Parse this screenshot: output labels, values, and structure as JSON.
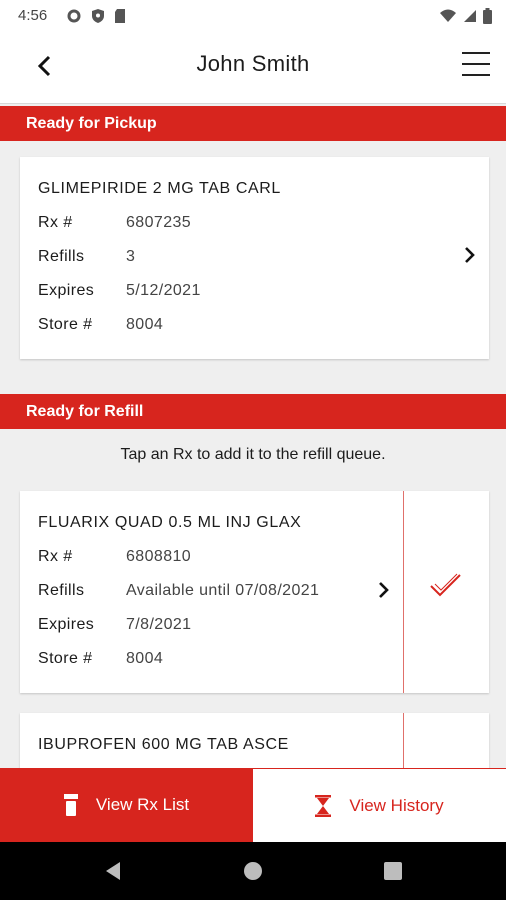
{
  "status_bar": {
    "time": "4:56"
  },
  "header": {
    "title": "John Smith"
  },
  "pickup": {
    "section_title": "Ready for Pickup",
    "card": {
      "name": "GLIMEPIRIDE 2 MG   TAB CARL",
      "rx_label": "Rx #",
      "rx": "6807235",
      "refills_label": "Refills",
      "refills": "3",
      "expires_label": "Expires",
      "expires": "5/12/2021",
      "store_label": "Store #",
      "store": "8004"
    }
  },
  "refill": {
    "section_title": "Ready for Refill",
    "hint": "Tap an Rx to add it to the refill queue.",
    "cards": [
      {
        "name": "FLUARIX QUAD 0.5 ML INJ GLAX",
        "rx_label": "Rx #",
        "rx": "6808810",
        "refills_label": "Refills",
        "refills": "Available until 07/08/2021",
        "expires_label": "Expires",
        "expires": "7/8/2021",
        "store_label": "Store #",
        "store": "8004",
        "selected": true
      },
      {
        "name": "IBUPROFEN 600 MG   TAB ASCE"
      }
    ]
  },
  "tabs": {
    "rx_list": "View Rx List",
    "history": "View History"
  },
  "colors": {
    "brand_red": "#d7251e",
    "divider_red": "#e0706b"
  },
  "icons": [
    "settings-icon",
    "shield-icon",
    "sim-card-icon",
    "wifi-icon",
    "signal-icon",
    "battery-icon",
    "back-arrow-icon",
    "menu-icon",
    "chevron-right-icon",
    "checkmark-icon",
    "pill-bottle-icon",
    "hourglass-icon",
    "nav-back-icon",
    "nav-home-icon",
    "nav-recents-icon"
  ]
}
